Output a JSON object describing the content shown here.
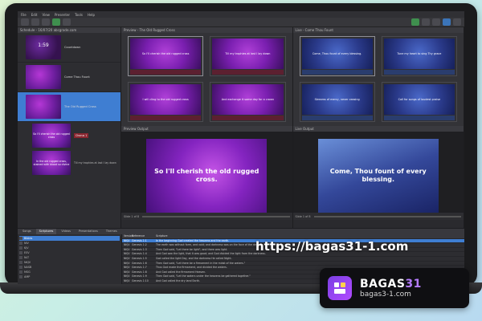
{
  "app": {
    "menu": [
      "File",
      "Edit",
      "View",
      "Presenter",
      "Tools",
      "Help"
    ]
  },
  "schedule": {
    "header": "Schedule - 16/07/20 abcgrade.com",
    "items": [
      {
        "thumb_text": "1:59",
        "label": "Countdown"
      },
      {
        "thumb_text": "",
        "label": "Come Thou Fount"
      },
      {
        "thumb_text": "",
        "label": "The Old Rugged Cross"
      }
    ],
    "sub_items": [
      {
        "text": "So I'll cherish the old rugged cross",
        "side": "Chorus 1"
      },
      {
        "text": "In the old rugged cross, stained with blood so divine",
        "side": "Till my trophies at last I lay down"
      }
    ]
  },
  "preview": {
    "header": "Preview - The Old Rugged Cross",
    "slides": [
      {
        "text": "So I'll cherish the old rugged cross",
        "selected": true
      },
      {
        "text": "Till my trophies at last I lay down",
        "selected": false
      },
      {
        "text": "I will cling to the old rugged cross",
        "selected": false
      },
      {
        "text": "And exchange it some day for a crown",
        "selected": false
      },
      {
        "text": "",
        "selected": false
      },
      {
        "text": "",
        "selected": false
      }
    ],
    "output_header": "Preview Output",
    "output_text": "So I'll cherish the old rugged cross.",
    "footer": "Slide 1 of 8"
  },
  "live": {
    "header": "Live - Come Thou Fount",
    "slides": [
      {
        "text": "Come, Thou fount of every blessing."
      },
      {
        "text": "Tune my heart to sing Thy grace"
      },
      {
        "text": "Streams of mercy, never ceasing"
      },
      {
        "text": "Call for songs of loudest praise"
      },
      {
        "text": ""
      },
      {
        "text": ""
      }
    ],
    "output_header": "Live Output",
    "output_text": "Come, Thou fount of every blessing.",
    "footer": "Slide 1 of 8"
  },
  "library": {
    "tabs": [
      "Songs",
      "Scriptures",
      "Videos",
      "Presentations",
      "Themes"
    ],
    "active_tab": "Scriptures",
    "tree": [
      "Bibles",
      "NIV",
      "KJV",
      "ESV",
      "NLT",
      "NKJV",
      "NASB",
      "MSG",
      "AMP"
    ],
    "columns": [
      "Version",
      "Reference",
      "Scripture"
    ],
    "rows": [
      [
        "NKJV",
        "Genesis 1:1",
        "In the beginning God created the heavens and the earth."
      ],
      [
        "NKJV",
        "Genesis 1:2",
        "The earth was without form, and void; and darkness was on the face of the deep."
      ],
      [
        "NKJV",
        "Genesis 1:3",
        "Then God said, \"Let there be light\"; and there was light."
      ],
      [
        "NKJV",
        "Genesis 1:4",
        "And God saw the light, that it was good; and God divided the light from the darkness."
      ],
      [
        "NKJV",
        "Genesis 1:5",
        "God called the light Day, and the darkness He called Night."
      ],
      [
        "NKJV",
        "Genesis 1:6",
        "Then God said, \"Let there be a firmament in the midst of the waters.\""
      ],
      [
        "NKJV",
        "Genesis 1:7",
        "Thus God made the firmament, and divided the waters."
      ],
      [
        "NKJV",
        "Genesis 1:8",
        "And God called the firmament Heaven."
      ],
      [
        "NKJV",
        "Genesis 1:9",
        "Then God said, \"Let the waters under the heavens be gathered together.\""
      ],
      [
        "NKJV",
        "Genesis 1:10",
        "And God called the dry land Earth."
      ]
    ]
  },
  "overlay": {
    "url": "https://bagas31-1.com",
    "brand_a": "BAGAS",
    "brand_b": "31",
    "brand_sub": "bagas3-1.com"
  }
}
